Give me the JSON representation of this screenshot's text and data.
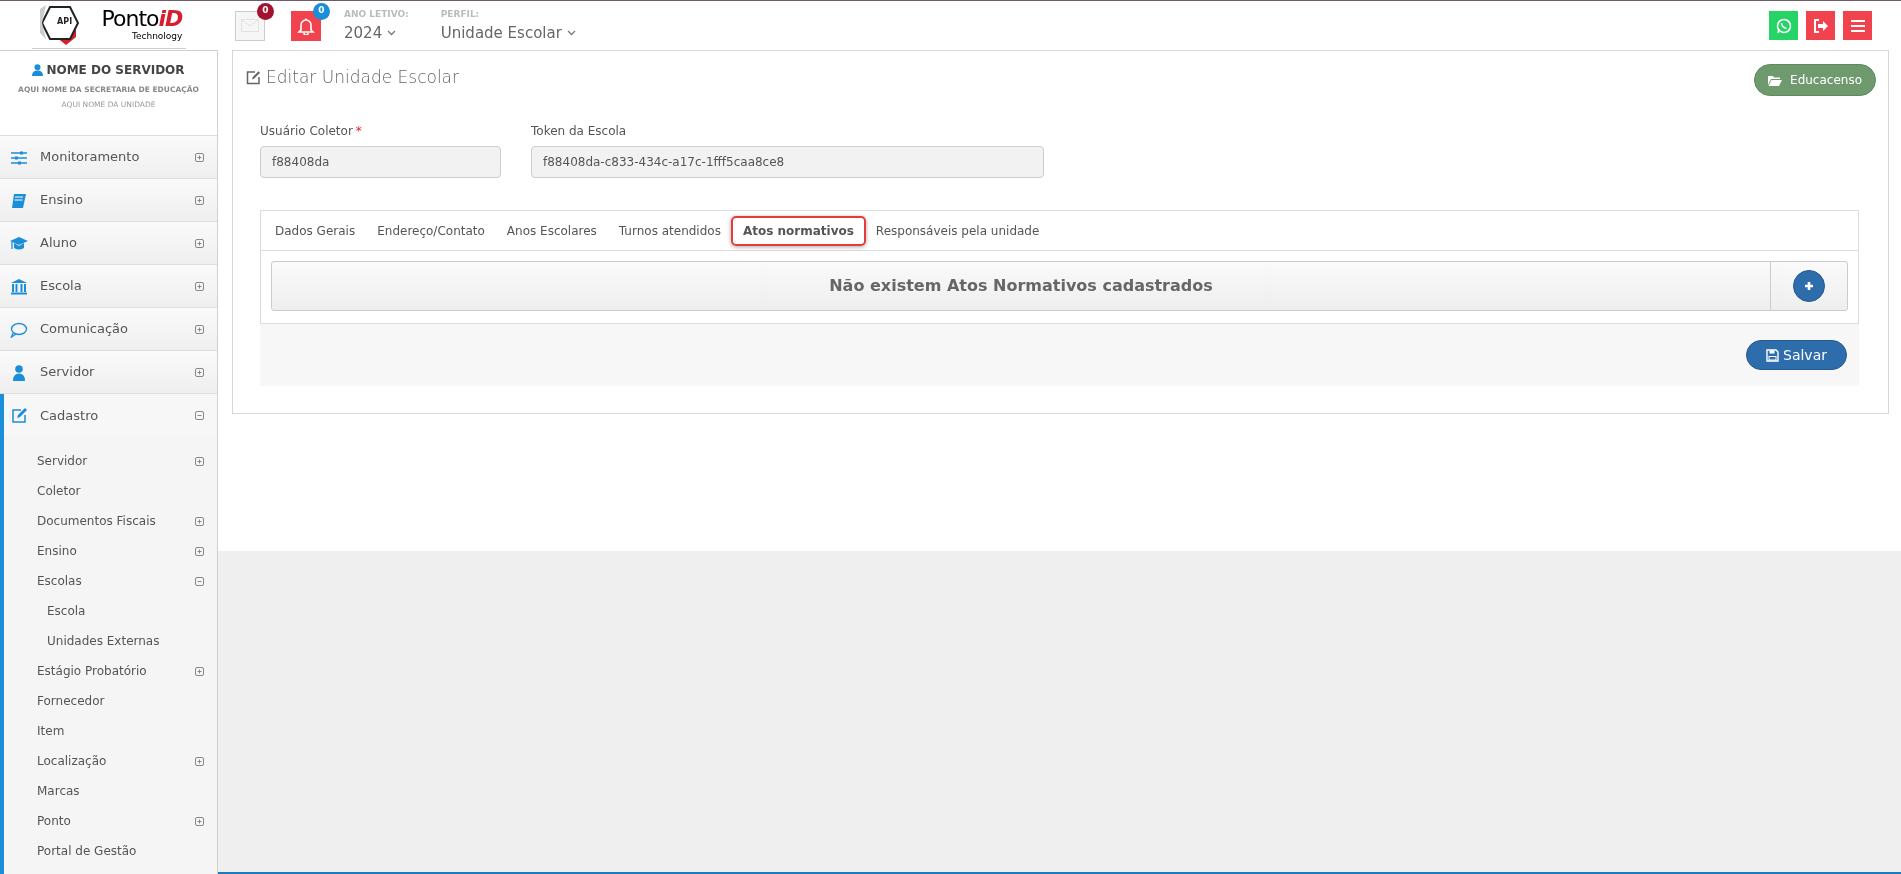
{
  "logo": {
    "badge": "API",
    "name": "Ponto",
    "accent": "iD",
    "tagline": "Technology"
  },
  "header": {
    "notifications": [
      {
        "kind": "mail",
        "count": "0"
      },
      {
        "kind": "bell",
        "count": "0"
      }
    ],
    "school_year": {
      "label": "ANO LETIVO:",
      "value": "2024"
    },
    "profile": {
      "label": "PERFIL:",
      "value": "Unidade Escolar"
    },
    "actions": [
      {
        "kind": "whatsapp"
      },
      {
        "kind": "logout"
      },
      {
        "kind": "menu"
      }
    ]
  },
  "sidebar": {
    "user": {
      "name": "NOME DO SERVIDOR",
      "secretaria": "AQUI NOME DA SECRETARIA DE EDUCAÇÃO",
      "unidade": "AQUI NOME DA UNIDADE"
    },
    "items": [
      {
        "label": "Monitoramento",
        "kind": "sliders",
        "expanded": false
      },
      {
        "label": "Ensino",
        "kind": "book",
        "expanded": false
      },
      {
        "label": "Aluno",
        "kind": "graduation",
        "expanded": false
      },
      {
        "label": "Escola",
        "kind": "bank",
        "expanded": false
      },
      {
        "label": "Comunicação",
        "kind": "chat",
        "expanded": false
      },
      {
        "label": "Servidor",
        "kind": "user",
        "expanded": false
      },
      {
        "label": "Cadastro",
        "kind": "edit",
        "expanded": true,
        "children": [
          {
            "label": "Servidor",
            "expanded": false
          },
          {
            "label": "Coletor"
          },
          {
            "label": "Documentos Fiscais",
            "expanded": false
          },
          {
            "label": "Ensino",
            "expanded": false
          },
          {
            "label": "Escolas",
            "expanded": true,
            "children": [
              {
                "label": "Escola"
              },
              {
                "label": "Unidades Externas"
              }
            ]
          },
          {
            "label": "Estágio Probatório",
            "expanded": false
          },
          {
            "label": "Fornecedor"
          },
          {
            "label": "Item"
          },
          {
            "label": "Localização",
            "expanded": false
          },
          {
            "label": "Marcas"
          },
          {
            "label": "Ponto",
            "expanded": false
          },
          {
            "label": "Portal de Gestão"
          }
        ]
      }
    ]
  },
  "main": {
    "title": "Editar Unidade Escolar",
    "educacenso_button": "Educacenso",
    "fields": [
      {
        "label": "Usuário Coletor",
        "required_mark": "*",
        "value": "f88408da"
      },
      {
        "label": "Token da Escola",
        "value": "f88408da-c833-434c-a17c-1fff5caa8ce8"
      }
    ],
    "tabs": [
      {
        "label": "Dados Gerais",
        "selected": false
      },
      {
        "label": "Endereço/Contato",
        "selected": false
      },
      {
        "label": "Anos Escolares",
        "selected": false
      },
      {
        "label": "Turnos atendidos",
        "selected": false
      },
      {
        "label": "Atos normativos",
        "selected": true
      },
      {
        "label": "Responsáveis pela unidade",
        "selected": false
      }
    ],
    "empty_message": "Não existem Atos Normativos cadastrados",
    "save_button": "Salvar"
  }
}
